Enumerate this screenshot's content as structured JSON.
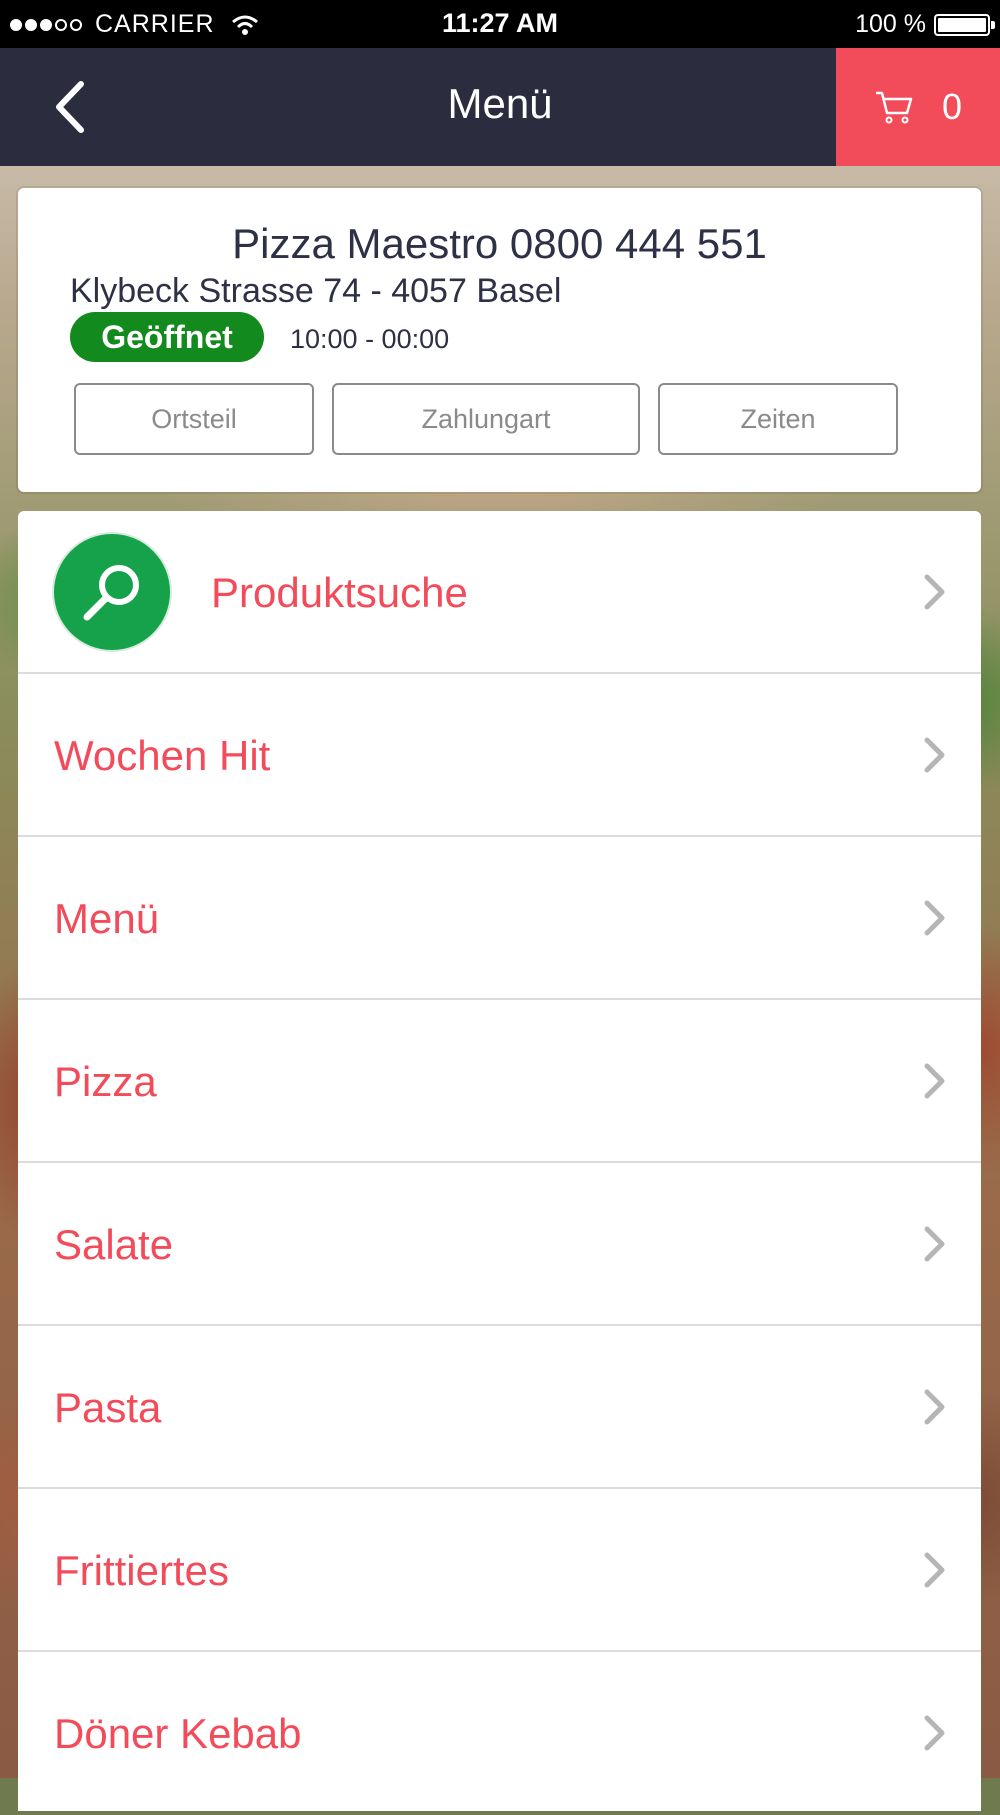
{
  "status_bar": {
    "carrier": "CARRIER",
    "time": "11:27 AM",
    "battery": "100 %",
    "battery_level": 1.0,
    "signal_bars_filled": 3,
    "signal_bars_total": 5
  },
  "nav": {
    "title": "Menü",
    "back_icon": "chevron-left-icon",
    "cart_icon": "cart-icon",
    "cart_count": "0"
  },
  "restaurant": {
    "name": "Pizza Maestro 0800 444 551",
    "address": "Klybeck Strasse 74 - 4057 Basel",
    "status": "Geöffnet",
    "hours": "10:00 - 00:00",
    "buttons": {
      "district": "Ortsteil",
      "payment": "Zahlungart",
      "times": "Zeiten"
    }
  },
  "menu": {
    "search_label": "Produktsuche",
    "search_icon": "search-icon",
    "items": [
      "Wochen Hit",
      "Menü",
      "Pizza",
      "Salate",
      "Pasta",
      "Frittiertes",
      "Döner Kebab"
    ]
  },
  "colors": {
    "nav_background": "#2b2d3e",
    "accent_red": "#f24b5a",
    "open_green": "#138a1e",
    "search_green": "#16a24a"
  }
}
